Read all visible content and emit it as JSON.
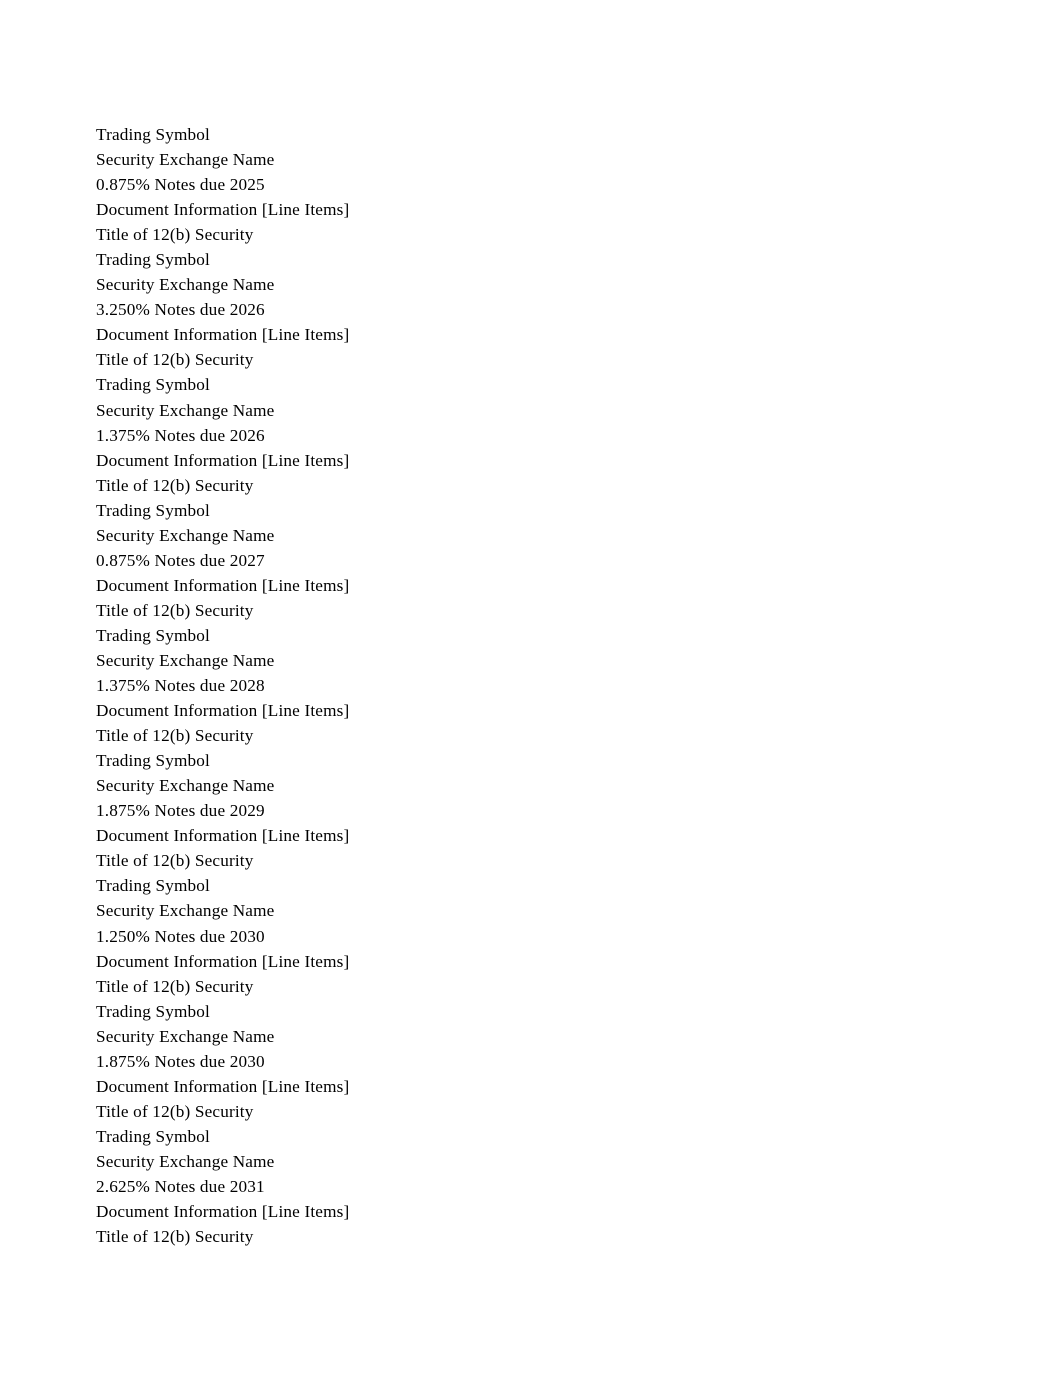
{
  "document": {
    "background_color": "#ffffff",
    "text_color": "#000000",
    "lines": [
      "Trading Symbol",
      "Security Exchange Name",
      "0.875% Notes due 2025",
      "Document Information [Line Items]",
      "Title of 12(b) Security",
      "Trading Symbol",
      "Security Exchange Name",
      "3.250% Notes due 2026",
      "Document Information [Line Items]",
      "Title of 12(b) Security",
      "Trading Symbol",
      "Security Exchange Name",
      "1.375% Notes due 2026",
      "Document Information [Line Items]",
      "Title of 12(b) Security",
      "Trading Symbol",
      "Security Exchange Name",
      "0.875% Notes due 2027",
      "Document Information [Line Items]",
      "Title of 12(b) Security",
      "Trading Symbol",
      "Security Exchange Name",
      "1.375% Notes due 2028",
      "Document Information [Line Items]",
      "Title of 12(b) Security",
      "Trading Symbol",
      "Security Exchange Name",
      "1.875% Notes due 2029",
      "Document Information [Line Items]",
      "Title of 12(b) Security",
      "Trading Symbol",
      "Security Exchange Name",
      "1.250% Notes due 2030",
      "Document Information [Line Items]",
      "Title of 12(b) Security",
      "Trading Symbol",
      "Security Exchange Name",
      "1.875% Notes due 2030",
      "Document Information [Line Items]",
      "Title of 12(b) Security",
      "Trading Symbol",
      "Security Exchange Name",
      "2.625% Notes due 2031",
      "Document Information [Line Items]",
      "Title of 12(b) Security"
    ]
  }
}
